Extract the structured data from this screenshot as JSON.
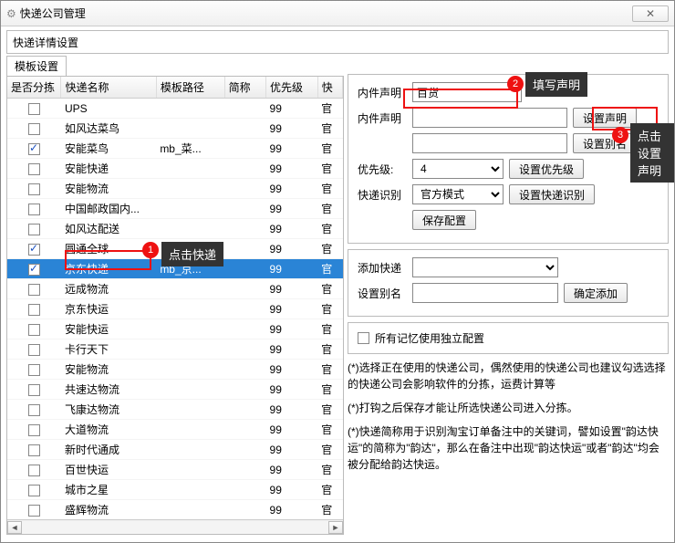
{
  "window": {
    "title": "快递公司管理",
    "close_glyph": "✕"
  },
  "subheader": "快递详情设置",
  "tab": "模板设置",
  "columns": [
    "是否分拣",
    "快递名称",
    "模板路径",
    "简称",
    "优先级",
    "快"
  ],
  "rows": [
    {
      "chk": false,
      "name": "UPS",
      "path": "",
      "abbr": "",
      "pri": "99",
      "r": "官"
    },
    {
      "chk": false,
      "name": "如风达菜鸟",
      "path": "",
      "abbr": "",
      "pri": "99",
      "r": "官"
    },
    {
      "chk": true,
      "name": "安能菜鸟",
      "path": "mb_菜...",
      "abbr": "",
      "pri": "99",
      "r": "官"
    },
    {
      "chk": false,
      "name": "安能快递",
      "path": "",
      "abbr": "",
      "pri": "99",
      "r": "官"
    },
    {
      "chk": false,
      "name": "安能物流",
      "path": "",
      "abbr": "",
      "pri": "99",
      "r": "官"
    },
    {
      "chk": false,
      "name": "中国邮政国内...",
      "path": "",
      "abbr": "",
      "pri": "99",
      "r": "官"
    },
    {
      "chk": false,
      "name": "如风达配送",
      "path": "",
      "abbr": "",
      "pri": "99",
      "r": "官"
    },
    {
      "chk": true,
      "name": "圆通全球",
      "path": "",
      "abbr": "",
      "pri": "99",
      "r": "官"
    },
    {
      "chk": true,
      "name": "京东快递",
      "path": "mb_京...",
      "abbr": "",
      "pri": "99",
      "r": "官",
      "sel": true
    },
    {
      "chk": false,
      "name": "远成物流",
      "path": "",
      "abbr": "",
      "pri": "99",
      "r": "官"
    },
    {
      "chk": false,
      "name": "京东快运",
      "path": "",
      "abbr": "",
      "pri": "99",
      "r": "官"
    },
    {
      "chk": false,
      "name": "安能快运",
      "path": "",
      "abbr": "",
      "pri": "99",
      "r": "官"
    },
    {
      "chk": false,
      "name": "卡行天下",
      "path": "",
      "abbr": "",
      "pri": "99",
      "r": "官"
    },
    {
      "chk": false,
      "name": "安能物流",
      "path": "",
      "abbr": "",
      "pri": "99",
      "r": "官"
    },
    {
      "chk": false,
      "name": "共速达物流",
      "path": "",
      "abbr": "",
      "pri": "99",
      "r": "官"
    },
    {
      "chk": false,
      "name": "飞康达物流",
      "path": "",
      "abbr": "",
      "pri": "99",
      "r": "官"
    },
    {
      "chk": false,
      "name": "大道物流",
      "path": "",
      "abbr": "",
      "pri": "99",
      "r": "官"
    },
    {
      "chk": false,
      "name": "新时代通成",
      "path": "",
      "abbr": "",
      "pri": "99",
      "r": "官"
    },
    {
      "chk": false,
      "name": "百世快运",
      "path": "",
      "abbr": "",
      "pri": "99",
      "r": "官"
    },
    {
      "chk": false,
      "name": "城市之星",
      "path": "",
      "abbr": "",
      "pri": "99",
      "r": "官"
    },
    {
      "chk": false,
      "name": "盛辉物流",
      "path": "",
      "abbr": "",
      "pri": "99",
      "r": "官"
    }
  ],
  "form": {
    "decl1_label": "内件声明",
    "decl1_value": "百货",
    "decl2_label": "内件声明",
    "decl2_btn": "设置声明",
    "decl2_btn2": "设置别名",
    "pri_label": "优先级:",
    "pri_value": "4",
    "pri_btn": "设置优先级",
    "rec_label": "快递识别",
    "rec_value": "官方模式",
    "rec_btn": "设置快递识别",
    "save_btn": "保存配置",
    "add_label": "添加快递",
    "alias_label": "设置别名",
    "add_btn": "确定添加",
    "indep_label": "所有记忆使用独立配置"
  },
  "notes": {
    "n1": "(*)选择正在使用的快递公司，偶然使用的快递公司也建议勾选选择的快递公司会影响软件的分拣，运费计算等",
    "n2": "(*)打钩之后保存才能让所选快递公司进入分拣。",
    "n3": "(*)快递简称用于识别淘宝订单备注中的关键词，譬如设置\"韵达快运\"的简称为\"韵达\"，那么在备注中出现\"韵达快运\"或者\"韵达\"均会被分配给韵达快运。"
  },
  "annot": {
    "tip1": "点击快递",
    "tip2": "填写声明",
    "tip3": "点击设置声明",
    "b1": "1",
    "b2": "2",
    "b3": "3"
  }
}
